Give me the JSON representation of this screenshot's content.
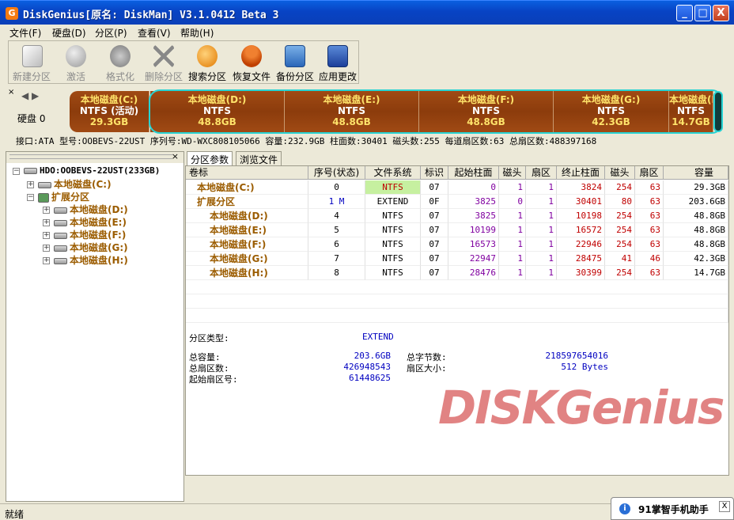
{
  "window": {
    "title": "DiskGenius[原名: DiskMan] V3.1.0412 Beta 3",
    "app_icon": "G"
  },
  "window_buttons": {
    "minimize": "_",
    "maximize": "□",
    "close": "X"
  },
  "menu": [
    "文件(F)",
    "硬盘(D)",
    "分区(P)",
    "查看(V)",
    "帮助(H)"
  ],
  "toolbar": [
    {
      "label": "新建分区",
      "icon": "new-partition-icon",
      "enabled": false
    },
    {
      "label": "激活",
      "icon": "activate-icon",
      "enabled": false
    },
    {
      "label": "格式化",
      "icon": "format-icon",
      "enabled": false
    },
    {
      "label": "删除分区",
      "icon": "delete-partition-icon",
      "enabled": false
    },
    {
      "label": "搜索分区",
      "icon": "search-partition-icon",
      "enabled": true
    },
    {
      "label": "恢复文件",
      "icon": "recover-files-icon",
      "enabled": true
    },
    {
      "label": "备份分区",
      "icon": "backup-partition-icon",
      "enabled": true
    },
    {
      "label": "应用更改",
      "icon": "apply-changes-icon",
      "enabled": true
    }
  ],
  "disk_label": "硬盘 0",
  "nav_arrows": "◀ ▶",
  "partitions_bar": [
    {
      "name": "本地磁盘(C:)",
      "fs": "NTFS (活动)",
      "size": "29.3GB"
    },
    {
      "name": "本地磁盘(D:)",
      "fs": "NTFS",
      "size": "48.8GB"
    },
    {
      "name": "本地磁盘(E:)",
      "fs": "NTFS",
      "size": "48.8GB"
    },
    {
      "name": "本地磁盘(F:)",
      "fs": "NTFS",
      "size": "48.8GB"
    },
    {
      "name": "本地磁盘(G:)",
      "fs": "NTFS",
      "size": "42.3GB"
    },
    {
      "name": "本地磁盘(H",
      "fs": "NTFS",
      "size": "14.7GB"
    }
  ],
  "disk_info": "接口:ATA  型号:OOBEVS-22UST  序列号:WD-WXC808105066  容量:232.9GB  柱面数:30401  磁头数:255  每道扇区数:63  总扇区数:488397168",
  "tree": {
    "root": "HDO:OOBEVS-22UST(233GB)",
    "items": [
      {
        "label": "本地磁盘(C:)",
        "level": 1
      },
      {
        "label": "扩展分区",
        "level": 1
      },
      {
        "label": "本地磁盘(D:)",
        "level": 2
      },
      {
        "label": "本地磁盘(E:)",
        "level": 2
      },
      {
        "label": "本地磁盘(F:)",
        "level": 2
      },
      {
        "label": "本地磁盘(G:)",
        "level": 2
      },
      {
        "label": "本地磁盘(H:)",
        "level": 2
      }
    ]
  },
  "tabs": [
    "分区参数",
    "浏览文件"
  ],
  "table": {
    "headers": [
      "卷标",
      "序号(状态)",
      "文件系统",
      "标识",
      "起始柱面",
      "磁头",
      "扇区",
      "终止柱面",
      "磁头",
      "扇区",
      "容量"
    ],
    "rows": [
      [
        "本地磁盘(C:)",
        "0",
        "NTFS",
        "07",
        "0",
        "1",
        "1",
        "3824",
        "254",
        "63",
        "29.3GB"
      ],
      [
        "扩展分区",
        "1 M",
        "EXTEND",
        "0F",
        "3825",
        "0",
        "1",
        "30401",
        "80",
        "63",
        "203.6GB"
      ],
      [
        "本地磁盘(D:)",
        "4",
        "NTFS",
        "07",
        "3825",
        "1",
        "1",
        "10198",
        "254",
        "63",
        "48.8GB"
      ],
      [
        "本地磁盘(E:)",
        "5",
        "NTFS",
        "07",
        "10199",
        "1",
        "1",
        "16572",
        "254",
        "63",
        "48.8GB"
      ],
      [
        "本地磁盘(F:)",
        "6",
        "NTFS",
        "07",
        "16573",
        "1",
        "1",
        "22946",
        "254",
        "63",
        "48.8GB"
      ],
      [
        "本地磁盘(G:)",
        "7",
        "NTFS",
        "07",
        "22947",
        "1",
        "1",
        "28475",
        "41",
        "46",
        "42.3GB"
      ],
      [
        "本地磁盘(H:)",
        "8",
        "NTFS",
        "07",
        "28476",
        "1",
        "1",
        "30399",
        "254",
        "63",
        "14.7GB"
      ]
    ]
  },
  "watermark": "DISKGenius",
  "details": {
    "type_label": "分区类型:",
    "type_value": "EXTEND",
    "total_cap_label": "总容量:",
    "total_cap_value": "203.6GB",
    "total_bytes_label": "总字节数:",
    "total_bytes_value": "218597654016",
    "total_sectors_label": "总扇区数:",
    "total_sectors_value": "426948543",
    "sector_size_label": "扇区大小:",
    "sector_size_value": "512 Bytes",
    "start_sector_label": "起始扇区号:",
    "start_sector_value": "61448625"
  },
  "status": "就绪",
  "popup": {
    "text": "91掌智手机助手",
    "icon": "i",
    "close": "X"
  }
}
